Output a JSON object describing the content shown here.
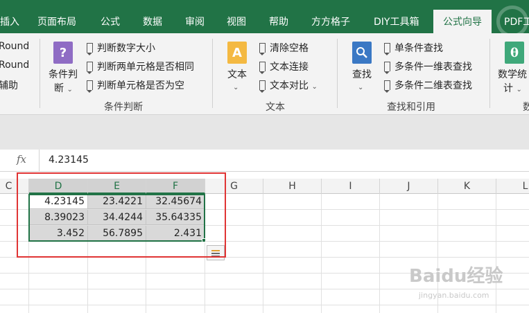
{
  "ribbon": {
    "tabs": [
      "插入",
      "页面布局",
      "公式",
      "数据",
      "审阅",
      "视图",
      "帮助",
      "方方格子",
      "DIY工具箱",
      "公式向导",
      "PDF工"
    ],
    "active_tab": "公式向导",
    "left_items": [
      "Round",
      "Round",
      "辅助"
    ],
    "groups": {
      "condition": {
        "label": "条件判断",
        "big_button": "条件判断",
        "items": [
          "判断数字大小",
          "判断两单元格是否相同",
          "判断单元格是否为空"
        ]
      },
      "text": {
        "label": "文本",
        "big_button": "文本",
        "items": [
          "清除空格",
          "文本连接",
          "文本对比"
        ]
      },
      "lookup": {
        "label": "查找和引用",
        "big_button": "查找",
        "items": [
          "单条件查找",
          "多条件一维表查找",
          "多条件二维表查找"
        ]
      },
      "math": {
        "big_button": "数学统计",
        "label_partial": "数"
      }
    }
  },
  "formula_bar": {
    "fx_label": "fx",
    "value": "4.23145"
  },
  "grid": {
    "columns": [
      "C",
      "D",
      "E",
      "F",
      "G",
      "H",
      "I",
      "J",
      "K",
      "L"
    ],
    "selected_columns": [
      "D",
      "E",
      "F"
    ],
    "rows": [
      [
        "4.23145",
        "23.4221",
        "32.45674"
      ],
      [
        "8.39023",
        "34.4244",
        "35.64335"
      ],
      [
        "3.452",
        "56.7895",
        "2.431"
      ]
    ]
  },
  "watermark": {
    "main": "Baidu经验",
    "sub": "jingyan.baidu.com"
  },
  "colors": {
    "ribbon_green": "#217346",
    "annotation_red": "#e03434",
    "selected_cell_gray": "#d9d9d9"
  }
}
